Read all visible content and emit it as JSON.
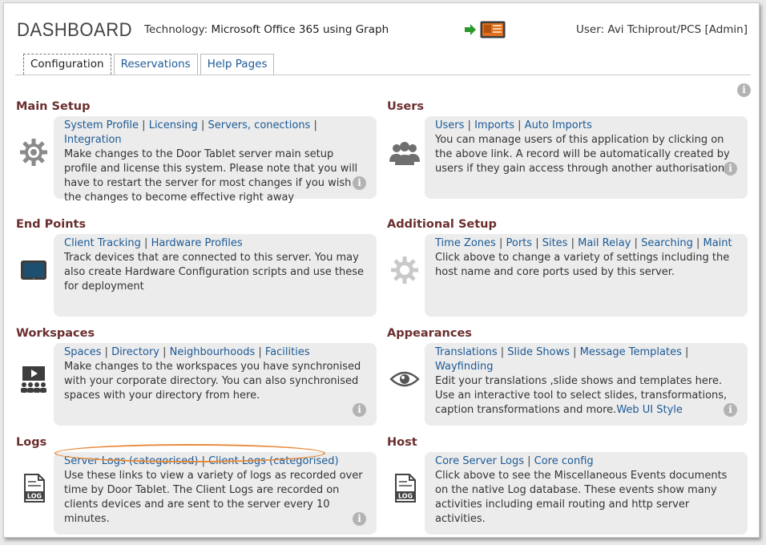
{
  "header": {
    "title": "DASHBOARD",
    "tech_label": "Technology:",
    "tech_value": "Microsoft Office 365 using Graph",
    "user": "User: Avi Tchiprout/PCS [Admin]"
  },
  "tabs": [
    {
      "label": "Configuration",
      "active": true
    },
    {
      "label": "Reservations",
      "active": false
    },
    {
      "label": "Help Pages",
      "active": false
    }
  ],
  "info_glyph": "i",
  "sections": {
    "main_setup": {
      "title": "Main Setup",
      "icon": "gear-icon",
      "links": [
        "System Profile",
        "Licensing",
        "Servers, conections",
        "Integration"
      ],
      "description": "Make changes to the Door Tablet server main setup profile and license this system. Please note that you will have to restart the server for most changes if you wish the changes to become effective right away"
    },
    "users": {
      "title": "Users",
      "icon": "users-icon",
      "links": [
        "Users",
        "Imports",
        "Auto Imports"
      ],
      "description": "You can manage users of this application by clicking on the above link. A record will be automatically created by users if they gain access through another authorisation"
    },
    "end_points": {
      "title": "End Points",
      "icon": "tablet-icon",
      "links": [
        "Client Tracking",
        "Hardware Profiles"
      ],
      "description": "Track devices that are connected to this server. You may also create Hardware Configuration scripts and use these for deployment"
    },
    "additional_setup": {
      "title": "Additional Setup",
      "icon": "cog-icon",
      "links": [
        "Time Zones",
        "Ports",
        "Sites",
        "Mail Relay",
        "Searching",
        "Maint"
      ],
      "description": "Click above to change a variety of settings including the host name and core ports used by this server."
    },
    "workspaces": {
      "title": "Workspaces",
      "icon": "presentation-icon",
      "links": [
        "Spaces",
        "Directory",
        "Neighbourhoods",
        "Facilities"
      ],
      "description": "Make changes to the workspaces you have synchronised with your corporate directory. You can also synchronised spaces with your directory from here."
    },
    "appearances": {
      "title": "Appearances",
      "icon": "eye-icon",
      "links": [
        "Translations",
        "Slide Shows",
        "Message Templates",
        "Wayfinding"
      ],
      "description": "Edit your translations ,slide shows and templates here. Use an interactive tool to select slides, transformations, caption transformations and more.",
      "extra_link": "Web UI Style"
    },
    "logs": {
      "title": "Logs",
      "icon": "log-file-icon",
      "links": [
        "Server Logs (categorised)",
        "Client Logs (categorised)"
      ],
      "description": "Use these links to view a variety of logs as recorded over time by Door Tablet. The Client Logs are recorded on clients devices and are sent to the server every 10 minutes."
    },
    "host": {
      "title": "Host",
      "icon": "log-file-icon",
      "links": [
        "Core Server Logs",
        "Core config"
      ],
      "description": "Click above to see the Miscellaneous Events documents on the native Log database. These events show many activities including email routing and http server activities."
    }
  },
  "colors": {
    "section_title": "#6b2e2e",
    "link": "#1c5a96",
    "card_bg": "#ececec",
    "highlight": "#e8893a",
    "arrow": "#2a9a2a"
  }
}
